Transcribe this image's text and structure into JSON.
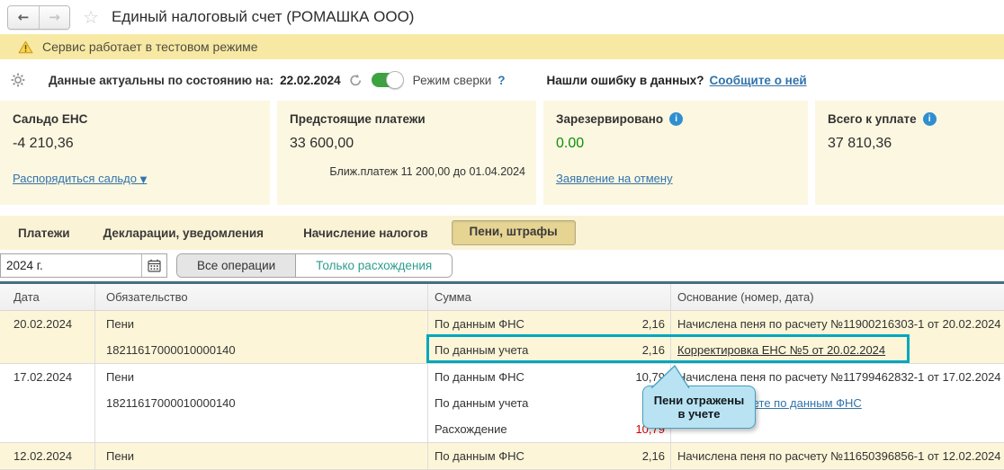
{
  "window": {
    "title": "Единый налоговый счет (РОМАШКА ООО)"
  },
  "icons": {
    "back_arrow": "←",
    "forward_arrow": "→",
    "star": "☆",
    "dropdown_arrow": "▼",
    "info": "i"
  },
  "banner": {
    "text": "Сервис работает в тестовом режиме"
  },
  "toolbar": {
    "actual_label": "Данные актуальны по состоянию на:",
    "actual_date": "22.02.2024",
    "mode_label": "Режим сверки",
    "help_label": "?",
    "error_question": "Нашли ошибку в данных?",
    "error_link": "Сообщите о ней"
  },
  "cards": {
    "0": {
      "title": "Сальдо ЕНС",
      "value": "-4 210,36",
      "link": "Распорядиться сальдо"
    },
    "1": {
      "title": "Предстоящие платежи",
      "value": "33 600,00",
      "note": "Ближ.платеж 11 200,00 до 01.04.2024"
    },
    "2": {
      "title": "Зарезервировано",
      "value": "0.00",
      "link": "Заявление на отмену"
    },
    "3": {
      "title": "Всего к уплате",
      "value": "37 810,36"
    }
  },
  "tabs": {
    "0": {
      "label": "Платежи"
    },
    "1": {
      "label": "Декларации, уведомления"
    },
    "2": {
      "label": "Начисление налогов"
    },
    "3": {
      "label": "Пени, штрафы",
      "active": true
    }
  },
  "filters": {
    "period": "2024 г.",
    "segment_all": "Все операции",
    "segment_diff": "Только расхождения"
  },
  "table": {
    "columns": {
      "date": "Дата",
      "obligation": "Обязательство",
      "sum": "Сумма",
      "basis": "Основание (номер, дата)"
    },
    "groups": [
      {
        "date": "20.02.2024",
        "obligation": "Пени",
        "kbk": "18211617000010000140",
        "rows": [
          {
            "sum_label": "По данным ФНС",
            "sum_value": "2,16",
            "basis": "Начислена пеня по расчету №11900216303-1 от 20.02.2024"
          },
          {
            "sum_label": "По данным учета",
            "sum_value": "2,16",
            "basis": "Корректировка ЕНС №5 от 20.02.2024"
          }
        ]
      },
      {
        "date": "17.02.2024",
        "obligation": "Пени",
        "kbk": "18211617000010000140",
        "rows": [
          {
            "sum_label": "По данным ФНС",
            "sum_value": "10,79",
            "basis": "Начислена пеня по расчету №11799462832-1 от 17.02.2024"
          },
          {
            "sum_label": "По данным учета",
            "sum_value": "",
            "basis": "Отразить в учете по данным ФНС"
          },
          {
            "sum_label": "Расхождение",
            "sum_value": "10,79",
            "basis": ""
          }
        ]
      },
      {
        "date": "12.02.2024",
        "obligation": "Пени",
        "rows": [
          {
            "sum_label": "По данным ФНС",
            "sum_value": "2,16",
            "basis": "Начислена пеня по расчету №11650396856-1 от 12.02.2024"
          }
        ]
      }
    ]
  },
  "tooltip": {
    "text": "Пени отражены в учете"
  },
  "colors": {
    "highlight_teal": "#00a6bd",
    "tooltip_bg": "#b9e3f2",
    "banner_yellow": "#f7e9a3",
    "card_bg": "#fcf7e1",
    "row_yellow": "#fcf5d8",
    "link_blue": "#3273ab",
    "negative_red": "#d40000",
    "positive_green": "#0d8f0d",
    "toggle_green": "#3da342"
  }
}
